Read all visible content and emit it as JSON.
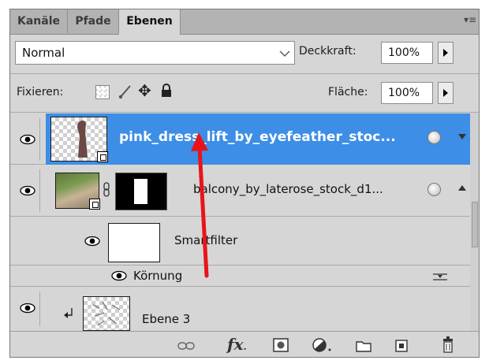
{
  "tabs": [
    {
      "label": "Kanäle"
    },
    {
      "label": "Pfade"
    },
    {
      "label": "Ebenen"
    }
  ],
  "blend_mode": {
    "value": "Normal"
  },
  "opacity": {
    "label": "Deckkraft:",
    "value": "100%"
  },
  "lock": {
    "label": "Fixieren:"
  },
  "fill": {
    "label": "Fläche:",
    "value": "100%"
  },
  "layers": [
    {
      "name": "pink_dress_lift_by_eyefeather_stoc...",
      "selected": true
    },
    {
      "name": "balcony_by_laterose_stock_d1..."
    },
    {
      "name": "Smartfilter"
    },
    {
      "name": "Körnung"
    },
    {
      "name": "Ebene 3"
    }
  ],
  "bottom_icons": [
    "link-layers-icon",
    "fx-icon",
    "add-mask-icon",
    "adjustment-layer-icon",
    "new-group-icon",
    "new-layer-icon",
    "trash-icon"
  ],
  "colors": {
    "selection": "#3d8ee6",
    "panel": "#d6d6d6",
    "arrow": "#e8141b"
  }
}
